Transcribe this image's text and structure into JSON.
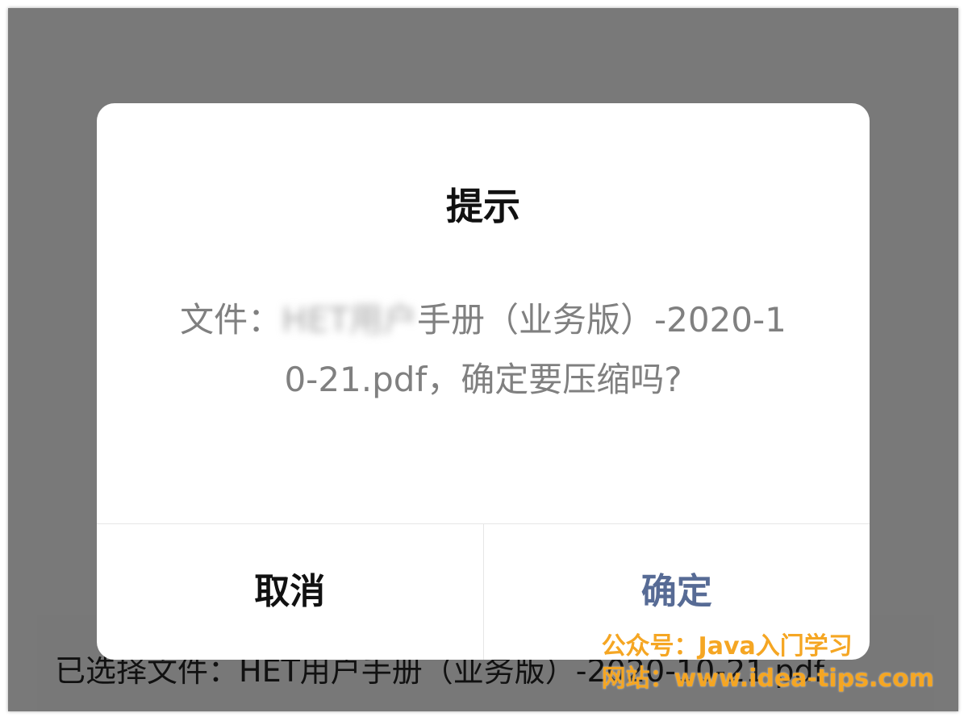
{
  "background": {
    "selected_file_text": "已选择文件：HET用户手册（业务版）-2020-10-21.pdf"
  },
  "dialog": {
    "title": "提示",
    "content_prefix": "文件：",
    "content_blurred": "HET用户",
    "content_suffix": "手册（业务版）-2020-10-21.pdf，确定要压缩吗?",
    "cancel_label": "取消",
    "confirm_label": "确定"
  },
  "watermark": {
    "line1": "公众号：Java入门学习",
    "line2": "网站：www.idea-tips.com"
  },
  "colors": {
    "mask": "rgba(0,0,0,0.5)",
    "confirm_text": "#576b95",
    "watermark": "#f5a623"
  }
}
